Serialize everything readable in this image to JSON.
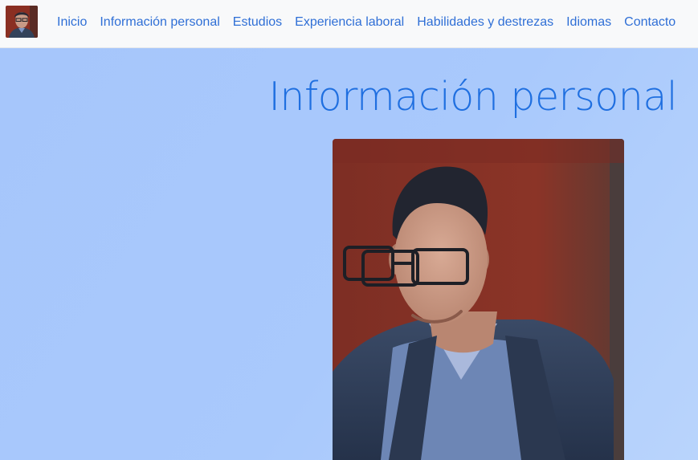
{
  "nav": {
    "brand_alt": "Foto de perfil",
    "links": [
      "Inicio",
      "Información personal",
      "Estudios",
      "Experiencia laboral",
      "Habilidades y destrezas",
      "Idiomas",
      "Contacto"
    ],
    "link_color": "#2f6fd6"
  },
  "main": {
    "title": "Información personal",
    "title_color": "#1f6fe0",
    "background_color": "#a8c8fc",
    "photo": {
      "subject": "portrait-photo",
      "description_icon": "person-photo"
    }
  }
}
